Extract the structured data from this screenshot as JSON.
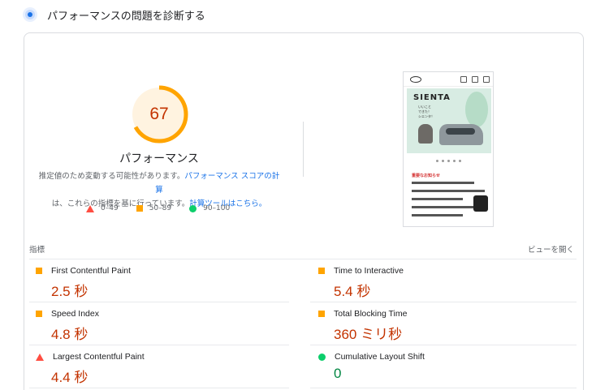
{
  "header": {
    "title": "パフォーマンスの問題を診断する",
    "icon": "lighthouse-category-icon"
  },
  "gauge": {
    "score": "67",
    "score_fraction": 0.67,
    "label": "パフォーマンス",
    "color": "#ffa400"
  },
  "description": {
    "text1": "推定値のため変動する可能性があります。",
    "link1": "パフォーマンス スコアの計算",
    "text2": "は、これらの指標を基に行っています。",
    "link2": "計算ツールはこちら。"
  },
  "legend": {
    "fail": "0–49",
    "average": "50–89",
    "pass": "90–100"
  },
  "screenshot": {
    "title": "SIENTA",
    "subtitle_lines": [
      "いいこと",
      "できた！",
      "シエンタ！"
    ],
    "news_title": "重要なお知らせ"
  },
  "metrics": {
    "section_label": "指標",
    "view_toggle": "ビューを開く",
    "items": [
      {
        "name": "First Contentful Paint",
        "value": "2.5 秒",
        "rating": "average"
      },
      {
        "name": "Time to Interactive",
        "value": "5.4 秒",
        "rating": "average"
      },
      {
        "name": "Speed Index",
        "value": "4.8 秒",
        "rating": "average"
      },
      {
        "name": "Total Blocking Time",
        "value": "360 ミリ秒",
        "rating": "average"
      },
      {
        "name": "Largest Contentful Paint",
        "value": "4.4 秒",
        "rating": "fail"
      },
      {
        "name": "Cumulative Layout Shift",
        "value": "0",
        "rating": "pass"
      }
    ]
  },
  "colors": {
    "fail": "#ff4e42",
    "average": "#ffa400",
    "pass": "#0cce6b",
    "link": "#1a73e8"
  }
}
